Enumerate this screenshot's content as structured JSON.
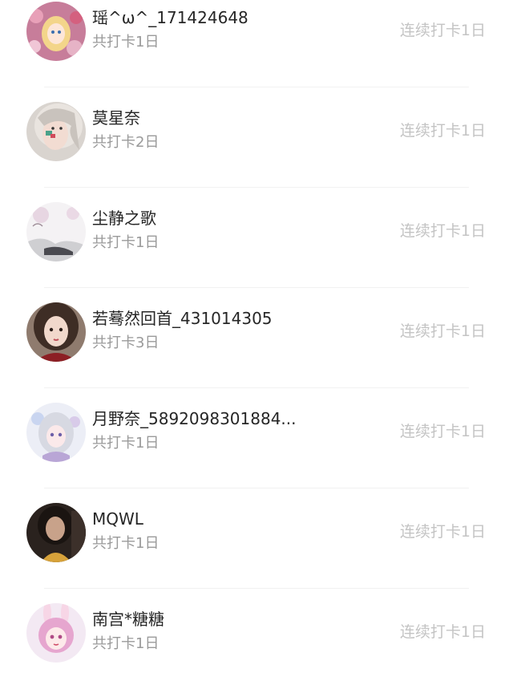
{
  "rows": [
    {
      "name": "瑶^ω^_171424648",
      "total": "共打卡1日",
      "streak": "连续打卡1日",
      "avatar": "avatar-anime-girl-flowers"
    },
    {
      "name": "莫星奈",
      "total": "共打卡2日",
      "streak": "连续打卡1日",
      "avatar": "avatar-girl-face-paint"
    },
    {
      "name": "尘静之歌",
      "total": "共打卡1日",
      "streak": "连续打卡1日",
      "avatar": "avatar-ink-landscape"
    },
    {
      "name": "若蓦然回首_431014305",
      "total": "共打卡3日",
      "streak": "连续打卡1日",
      "avatar": "avatar-dark-hair-girl"
    },
    {
      "name": "月野奈_5892098301884...",
      "total": "共打卡1日",
      "streak": "连续打卡1日",
      "avatar": "avatar-anime-silver-hair"
    },
    {
      "name": "MQWL",
      "total": "共打卡1日",
      "streak": "连续打卡1日",
      "avatar": "avatar-dark-photo"
    },
    {
      "name": "南宫*糖糖",
      "total": "共打卡1日",
      "streak": "连续打卡1日",
      "avatar": "avatar-anime-bunny-girl"
    }
  ]
}
